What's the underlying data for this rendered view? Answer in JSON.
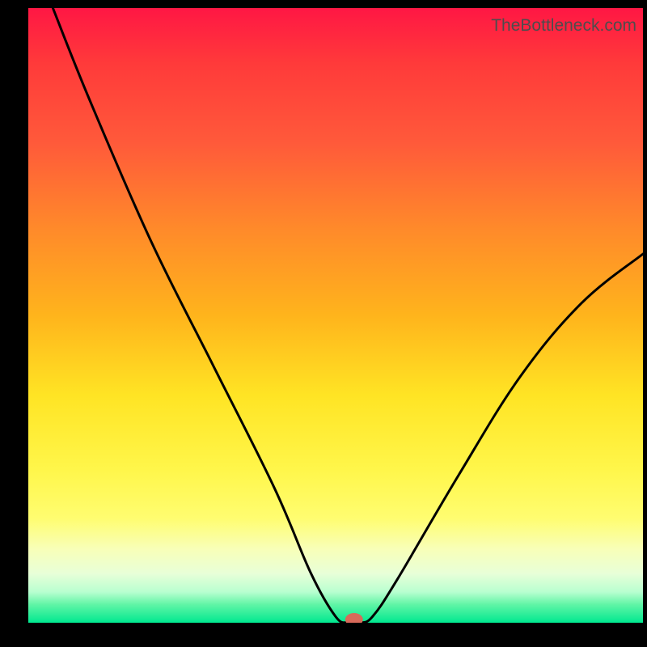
{
  "attribution": "TheBottleneck.com",
  "chart_data": {
    "type": "line",
    "title": "",
    "xlabel": "",
    "ylabel": "",
    "xlim": [
      0,
      100
    ],
    "ylim": [
      0,
      100
    ],
    "series": [
      {
        "name": "bottleneck-curve",
        "x": [
          4,
          10,
          20,
          30,
          40,
          46,
          50,
          52,
          54,
          56,
          60,
          70,
          80,
          90,
          100
        ],
        "y": [
          100,
          85,
          62,
          42,
          22,
          8,
          1,
          0,
          0,
          1,
          7,
          24,
          40,
          52,
          60
        ]
      }
    ],
    "marker": {
      "x": 53,
      "y": 0,
      "label": "optimal-point"
    },
    "gradient_stops": [
      {
        "pct": 0,
        "color": "#ff1744"
      },
      {
        "pct": 50,
        "color": "#ffe424"
      },
      {
        "pct": 100,
        "color": "#00e890"
      }
    ]
  }
}
